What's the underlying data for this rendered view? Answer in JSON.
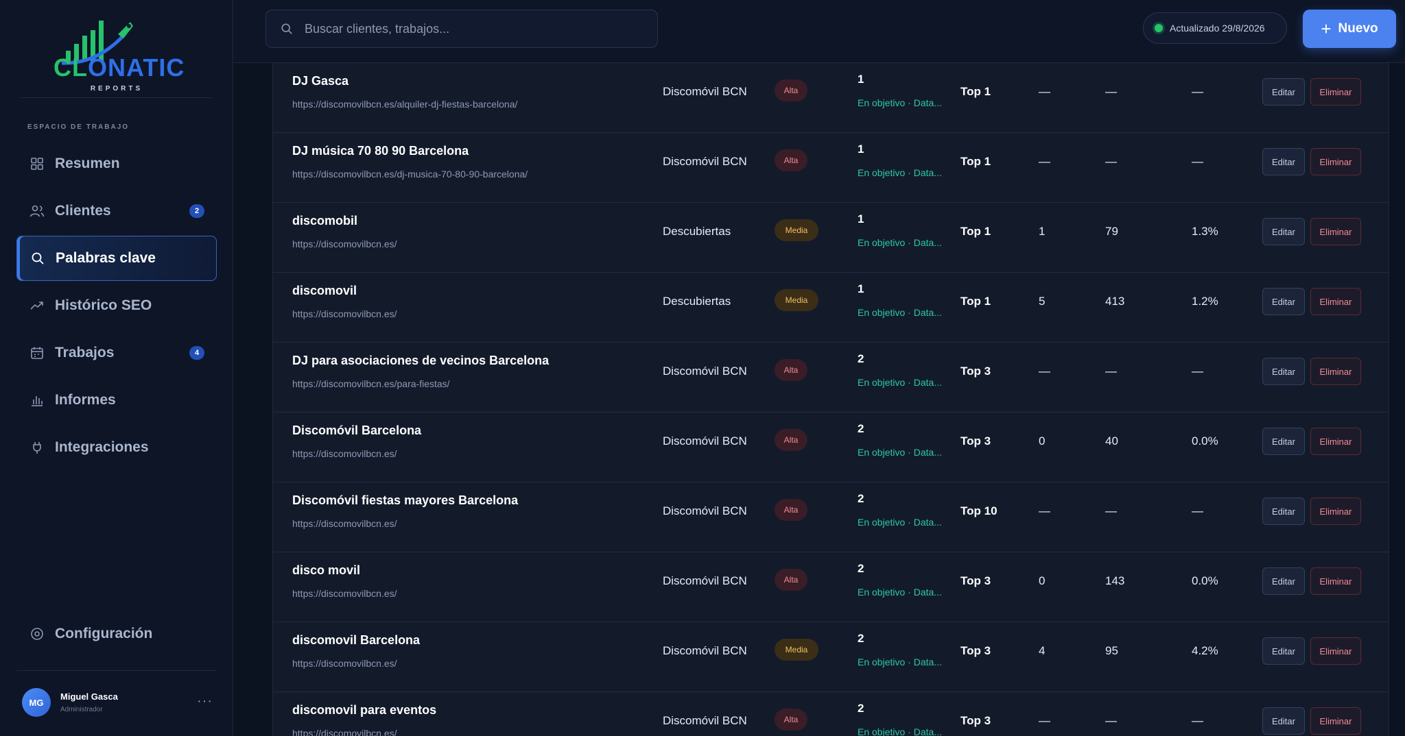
{
  "brand": {
    "name_a": "C",
    "name_b": "L",
    "name_c": "ONATIC",
    "subtitle": "REPORTS"
  },
  "sidebar": {
    "workspace_label": "ESPACIO DE TRABAJO",
    "items": [
      {
        "label": "Resumen",
        "icon": "grid-icon"
      },
      {
        "label": "Clientes",
        "icon": "users-icon",
        "badge": "2"
      },
      {
        "label": "Palabras clave",
        "icon": "search-icon",
        "active": true
      },
      {
        "label": "Histórico SEO",
        "icon": "trend-icon"
      },
      {
        "label": "Trabajos",
        "icon": "calendar-icon",
        "badge": "4"
      },
      {
        "label": "Informes",
        "icon": "bar-chart-icon"
      },
      {
        "label": "Integraciones",
        "icon": "plug-icon"
      }
    ],
    "config_label": "Configuración",
    "user": {
      "initials": "MG",
      "name": "Miguel Gasca",
      "role": "Administrador",
      "more": "···"
    }
  },
  "topbar": {
    "search_placeholder": "Buscar clientes, trabajos...",
    "status": "Actualizado 29/8/2026",
    "new_label": "Nuevo",
    "new_plus": "+"
  },
  "table": {
    "edit_label": "Editar",
    "delete_label": "Eliminar",
    "rows": [
      {
        "keyword": "DJ Gasca",
        "url": "https://discomovilbcn.es/alquiler-dj-fiestas-barcelona/",
        "group": "Discomóvil BCN",
        "priority": "Alta",
        "position": "1",
        "status": "En objetivo · Data...",
        "target": "Top 1",
        "c1": "—",
        "c2": "—",
        "c3": "—"
      },
      {
        "keyword": "DJ música 70 80 90 Barcelona",
        "url": "https://discomovilbcn.es/dj-musica-70-80-90-barcelona/",
        "group": "Discomóvil BCN",
        "priority": "Alta",
        "position": "1",
        "status": "En objetivo · Data...",
        "target": "Top 1",
        "c1": "—",
        "c2": "—",
        "c3": "—"
      },
      {
        "keyword": "discomobil",
        "url": "https://discomovilbcn.es/",
        "group": "Descubiertas",
        "priority": "Media",
        "position": "1",
        "status": "En objetivo · Data...",
        "target": "Top 1",
        "c1": "1",
        "c2": "79",
        "c3": "1.3%"
      },
      {
        "keyword": "discomovil",
        "url": "https://discomovilbcn.es/",
        "group": "Descubiertas",
        "priority": "Media",
        "position": "1",
        "status": "En objetivo · Data...",
        "target": "Top 1",
        "c1": "5",
        "c2": "413",
        "c3": "1.2%"
      },
      {
        "keyword": "DJ para asociaciones de vecinos Barcelona",
        "url": "https://discomovilbcn.es/para-fiestas/",
        "group": "Discomóvil BCN",
        "priority": "Alta",
        "position": "2",
        "status": "En objetivo · Data...",
        "target": "Top 3",
        "c1": "—",
        "c2": "—",
        "c3": "—"
      },
      {
        "keyword": "Discomóvil Barcelona",
        "url": "https://discomovilbcn.es/",
        "group": "Discomóvil BCN",
        "priority": "Alta",
        "position": "2",
        "status": "En objetivo · Data...",
        "target": "Top 3",
        "c1": "0",
        "c2": "40",
        "c3": "0.0%"
      },
      {
        "keyword": "Discomóvil fiestas mayores Barcelona",
        "url": "https://discomovilbcn.es/",
        "group": "Discomóvil BCN",
        "priority": "Alta",
        "position": "2",
        "status": "En objetivo · Data...",
        "target": "Top 10",
        "c1": "—",
        "c2": "—",
        "c3": "—"
      },
      {
        "keyword": "disco movil",
        "url": "https://discomovilbcn.es/",
        "group": "Discomóvil BCN",
        "priority": "Alta",
        "position": "2",
        "status": "En objetivo · Data...",
        "target": "Top 3",
        "c1": "0",
        "c2": "143",
        "c3": "0.0%"
      },
      {
        "keyword": "discomovil Barcelona",
        "url": "https://discomovilbcn.es/",
        "group": "Discomóvil BCN",
        "priority": "Media",
        "position": "2",
        "status": "En objetivo · Data...",
        "target": "Top 3",
        "c1": "4",
        "c2": "95",
        "c3": "4.2%"
      },
      {
        "keyword": "discomovil para eventos",
        "url": "https://discomovilbcn.es/",
        "group": "Discomóvil BCN",
        "priority": "Alta",
        "position": "2",
        "status": "En objetivo · Data...",
        "target": "Top 3",
        "c1": "—",
        "c2": "—",
        "c3": "—"
      }
    ]
  },
  "colors": {
    "accent": "#4b82f0",
    "success": "#27c26a",
    "danger": "#f08c93",
    "warning": "#f0c064"
  }
}
